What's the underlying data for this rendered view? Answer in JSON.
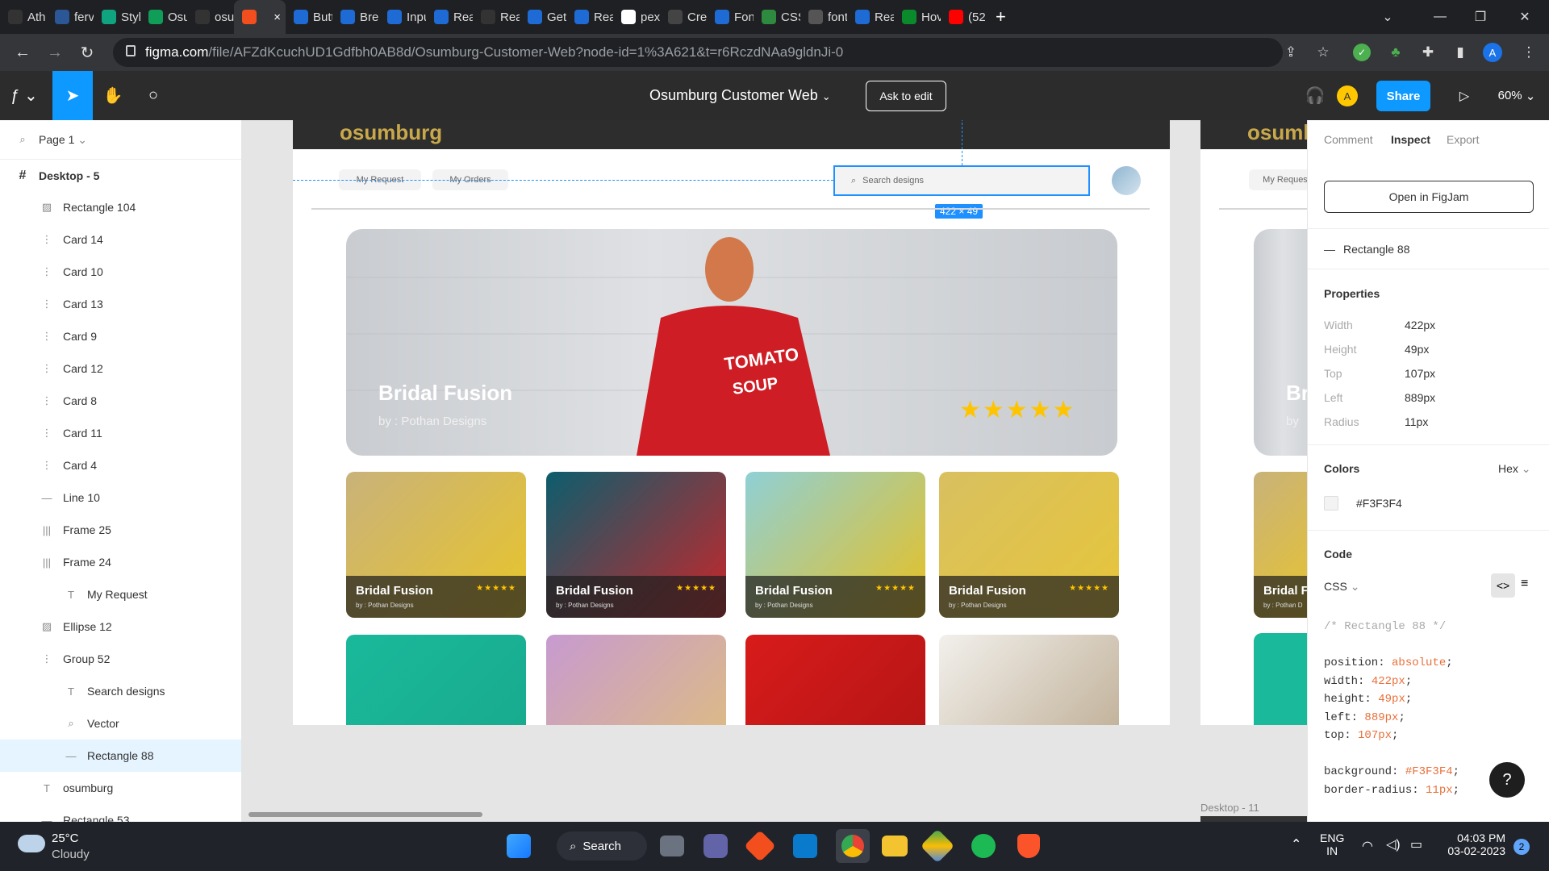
{
  "browser": {
    "tabs": [
      {
        "label": "Ath",
        "color": "#333"
      },
      {
        "label": "ferv",
        "color": "#2b5797"
      },
      {
        "label": "Styl",
        "color": "#10a37f"
      },
      {
        "label": "Osu",
        "color": "#0f9d58"
      },
      {
        "label": "osu",
        "color": "#333"
      },
      {
        "label": "",
        "color": "#f24e1e",
        "close": "×"
      },
      {
        "label": "Butt",
        "color": "#1e6bd6"
      },
      {
        "label": "Brea",
        "color": "#1e6bd6"
      },
      {
        "label": "Inpu",
        "color": "#1e6bd6"
      },
      {
        "label": "Rea",
        "color": "#1e6bd6"
      },
      {
        "label": "Rea",
        "color": "#333"
      },
      {
        "label": "Get",
        "color": "#1e6bd6"
      },
      {
        "label": "Rea",
        "color": "#1e6bd6"
      },
      {
        "label": "pex",
        "color": "#fff"
      },
      {
        "label": "Cre",
        "color": "#444"
      },
      {
        "label": "Fon",
        "color": "#1e6bd6"
      },
      {
        "label": "CSS",
        "color": "#2d8a3e"
      },
      {
        "label": "font",
        "color": "#555"
      },
      {
        "label": "Rea",
        "color": "#1e6bd6"
      },
      {
        "label": "Hov",
        "color": "#0a8a2a"
      },
      {
        "label": "(52",
        "color": "#ff0000"
      }
    ],
    "new_tab": "+",
    "url_host": "figma.com",
    "url_path": "/file/AFZdKcuchUD1Gdfbh0AB8d/Osumburg-Customer-Web?node-id=1%3A621&t=r6RczdNAa9gldnJi-0",
    "profile_initial": "A"
  },
  "figma": {
    "file_title": "Osumburg Customer Web",
    "ask_to_edit": "Ask to edit",
    "user_initial": "A",
    "share": "Share",
    "zoom": "60%"
  },
  "layers": {
    "page": "Page 1",
    "frame": "Desktop - 5",
    "items": [
      {
        "label": "Rectangle 104",
        "icon": "image-icon",
        "glyph": "▨",
        "indent": 0
      },
      {
        "label": "Card 14",
        "icon": "component-icon",
        "glyph": "⋮",
        "indent": 0
      },
      {
        "label": "Card 10",
        "icon": "component-icon",
        "glyph": "⋮",
        "indent": 0
      },
      {
        "label": "Card 13",
        "icon": "component-icon",
        "glyph": "⋮",
        "indent": 0
      },
      {
        "label": "Card 9",
        "icon": "component-icon",
        "glyph": "⋮",
        "indent": 0
      },
      {
        "label": "Card 12",
        "icon": "component-icon",
        "glyph": "⋮",
        "indent": 0
      },
      {
        "label": "Card 8",
        "icon": "component-icon",
        "glyph": "⋮",
        "indent": 0
      },
      {
        "label": "Card 11",
        "icon": "component-icon",
        "glyph": "⋮",
        "indent": 0
      },
      {
        "label": "Card 4",
        "icon": "component-icon",
        "glyph": "⋮",
        "indent": 0
      },
      {
        "label": "Line 10",
        "icon": "line-icon",
        "glyph": "—",
        "indent": 0
      },
      {
        "label": "Frame 25",
        "icon": "autolayout-icon",
        "glyph": "|||",
        "indent": 0
      },
      {
        "label": "Frame 24",
        "icon": "autolayout-icon",
        "glyph": "|||",
        "indent": 0
      },
      {
        "label": "My Request",
        "icon": "text-icon",
        "glyph": "T",
        "indent": 1
      },
      {
        "label": "Ellipse 12",
        "icon": "image-icon",
        "glyph": "▨",
        "indent": 0
      },
      {
        "label": "Group 52",
        "icon": "group-icon",
        "glyph": "⋮",
        "indent": 0
      },
      {
        "label": "Search designs",
        "icon": "text-icon",
        "glyph": "T",
        "indent": 1
      },
      {
        "label": "Vector",
        "icon": "search-icon",
        "glyph": "⌕",
        "indent": 1
      },
      {
        "label": "Rectangle 88",
        "icon": "rectangle-icon",
        "glyph": "—",
        "indent": 1,
        "selected": true
      },
      {
        "label": "osumburg",
        "icon": "text-icon",
        "glyph": "T",
        "indent": 0
      },
      {
        "label": "Rectangle 53",
        "icon": "rectangle-icon",
        "glyph": "—",
        "indent": 0
      }
    ]
  },
  "design": {
    "logo": "osumburg",
    "nav": [
      "My Request",
      "My Orders"
    ],
    "search_placeholder": "Search designs",
    "selection_size": "422 × 49",
    "hero": {
      "title": "Bridal Fusion",
      "subtitle": "by : Pothan Designs",
      "rating": "★★★★★"
    },
    "cards": [
      {
        "title": "Bridal Fusion",
        "subtitle": "by : Pothan Designs",
        "rating": "★★★★★",
        "colors": [
          "#c9b27a",
          "#e8c52a"
        ]
      },
      {
        "title": "Bridal Fusion",
        "subtitle": "by : Pothan Designs",
        "rating": "★★★★★",
        "colors": [
          "#0c5d6d",
          "#c8262a"
        ]
      },
      {
        "title": "Bridal Fusion",
        "subtitle": "by : Pothan Designs",
        "rating": "★★★★★",
        "colors": [
          "#8fd0d6",
          "#e8c020"
        ]
      },
      {
        "title": "Bridal Fusion",
        "subtitle": "by : Pothan Designs",
        "rating": "★★★★★",
        "colors": [
          "#d9c060",
          "#e6c53a"
        ]
      }
    ],
    "row2_colors": [
      [
        "#1ab99b",
        "#18a88c"
      ],
      [
        "#c79ad0",
        "#e0c07a"
      ],
      [
        "#d81b1b",
        "#b01414"
      ],
      [
        "#f2f0ec",
        "#b9a78c"
      ]
    ],
    "ghost": {
      "logo": "osumb",
      "nav": "My Reques",
      "hero_title": "Br",
      "hero_sub": "by",
      "card_title": "Bridal F",
      "card_sub": "by : Pothan D"
    },
    "frame_label": "Desktop - 11"
  },
  "inspect": {
    "tabs": [
      "Comment",
      "Inspect",
      "Export"
    ],
    "open_figjam": "Open in FigJam",
    "layer_name": "Rectangle 88",
    "properties_title": "Properties",
    "props": [
      {
        "k": "Width",
        "v": "422px"
      },
      {
        "k": "Height",
        "v": "49px"
      },
      {
        "k": "Top",
        "v": "107px"
      },
      {
        "k": "Left",
        "v": "889px"
      },
      {
        "k": "Radius",
        "v": "11px"
      }
    ],
    "colors_title": "Colors",
    "color_format": "Hex",
    "color_hex": "#F3F3F4",
    "code_title": "Code",
    "code_lang": "CSS",
    "code_lines": [
      {
        "text": "/* Rectangle 88 */",
        "kind": "comment"
      },
      {
        "text": "",
        "kind": "blank"
      },
      {
        "k": "position",
        "v": "absolute"
      },
      {
        "k": "width",
        "v": "422px"
      },
      {
        "k": "height",
        "v": "49px"
      },
      {
        "k": "left",
        "v": "889px"
      },
      {
        "k": "top",
        "v": "107px"
      },
      {
        "text": "",
        "kind": "blank"
      },
      {
        "k": "background",
        "v": "#F3F3F4"
      },
      {
        "k": "border-radius",
        "v": "11px"
      }
    ],
    "help": "?"
  },
  "taskbar": {
    "weather_temp": "25°C",
    "weather_desc": "Cloudy",
    "search_label": "Search",
    "lang": "ENG",
    "region": "IN",
    "time": "04:03 PM",
    "date": "03-02-2023",
    "notif_count": "2"
  }
}
